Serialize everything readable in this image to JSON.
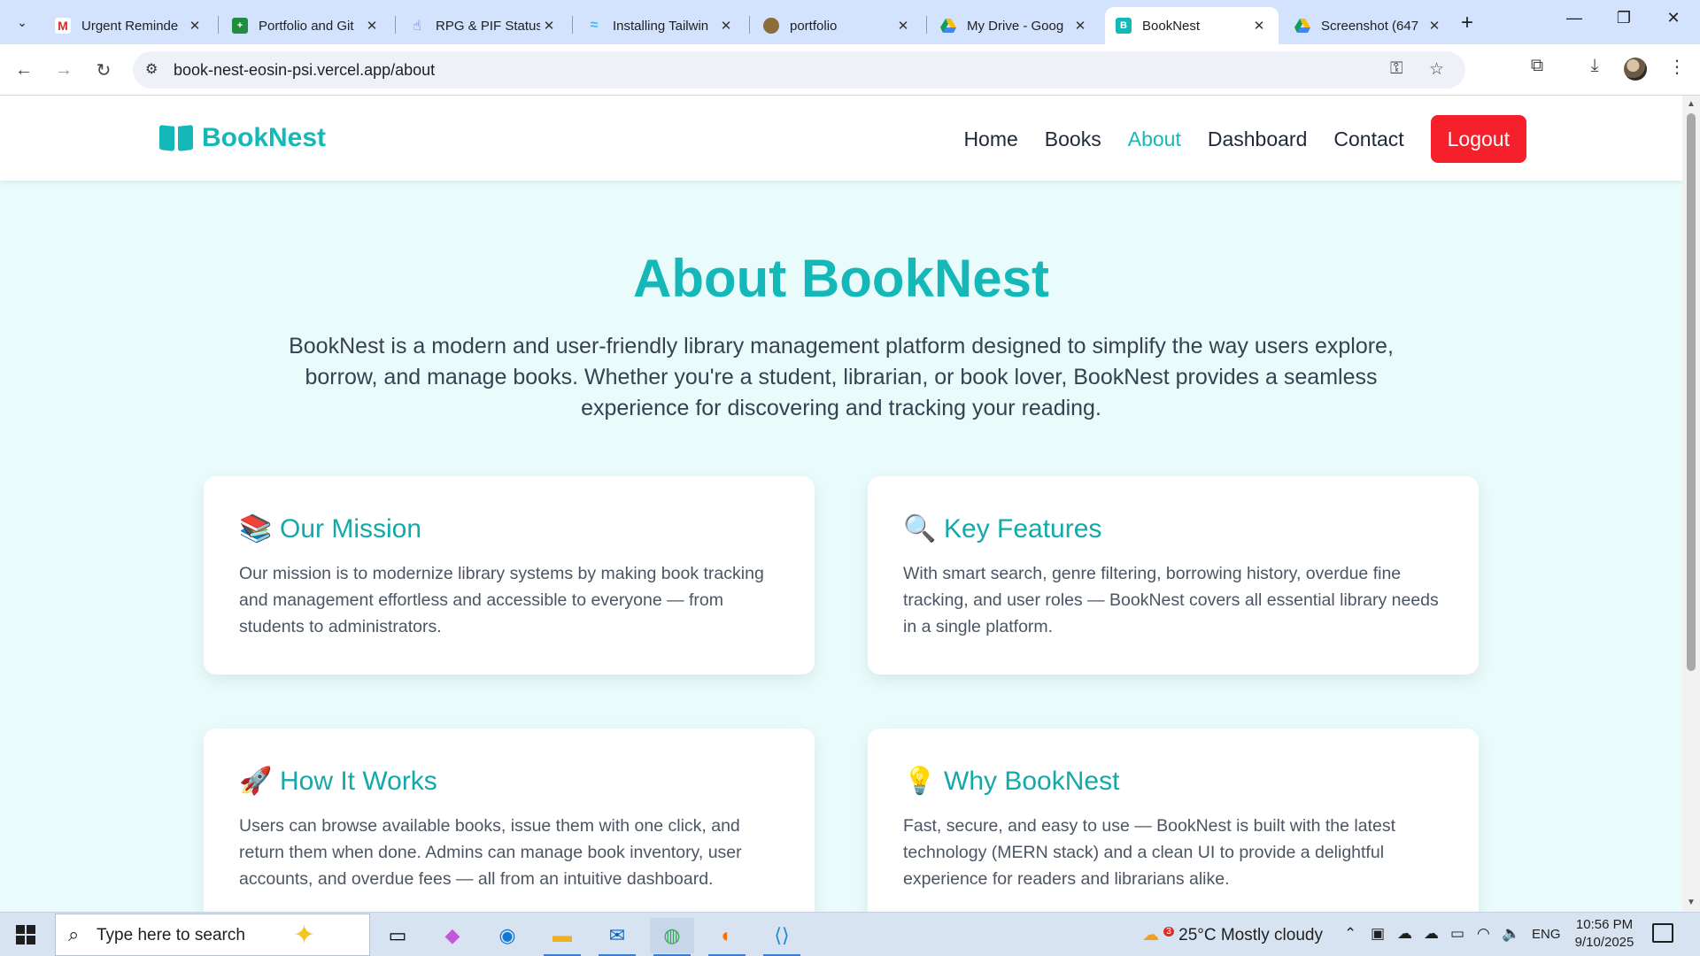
{
  "browser": {
    "tabs": [
      {
        "title": "Urgent Reminde",
        "favicon": "gmail-icon",
        "active": false
      },
      {
        "title": "Portfolio and Git",
        "favicon": "sheets-icon",
        "active": false
      },
      {
        "title": "RPG & PIF Status",
        "favicon": "hand-icon",
        "active": false
      },
      {
        "title": "Installing Tailwin",
        "favicon": "tailwind-icon",
        "active": false
      },
      {
        "title": "portfolio",
        "favicon": "portfolio-icon",
        "active": false
      },
      {
        "title": "My Drive - Goog",
        "favicon": "drive-icon",
        "active": false
      },
      {
        "title": "BookNest",
        "favicon": "B",
        "active": true
      },
      {
        "title": "Screenshot (647",
        "favicon": "drive-icon",
        "active": false
      }
    ],
    "url": "book-nest-eosin-psi.vercel.app/about"
  },
  "site": {
    "brand": "BookNest",
    "nav": [
      {
        "label": "Home",
        "active": false
      },
      {
        "label": "Books",
        "active": false
      },
      {
        "label": "About",
        "active": true
      },
      {
        "label": "Dashboard",
        "active": false
      },
      {
        "label": "Contact",
        "active": false
      }
    ],
    "logout_label": "Logout",
    "accent_color": "#14b8b8",
    "logout_color": "#f5202c"
  },
  "about": {
    "title": "About BookNest",
    "description": "BookNest is a modern and user-friendly library management platform designed to simplify the way users explore, borrow, and manage books. Whether you're a student, librarian, or book lover, BookNest provides a seamless experience for discovering and tracking your reading.",
    "cards": [
      {
        "emoji": "📚",
        "icon": "books-icon",
        "heading": "Our Mission",
        "text": "Our mission is to modernize library systems by making book tracking and management effortless and accessible to everyone — from students to administrators."
      },
      {
        "emoji": "🔍",
        "icon": "magnifier-icon",
        "heading": "Key Features",
        "text": "With smart search, genre filtering, borrowing history, overdue fine tracking, and user roles — BookNest covers all essential library needs in a single platform."
      },
      {
        "emoji": "🚀",
        "icon": "rocket-icon",
        "heading": "How It Works",
        "text": "Users can browse available books, issue them with one click, and return them when done. Admins can manage book inventory, user accounts, and overdue fees — all from an intuitive dashboard."
      },
      {
        "emoji": "💡",
        "icon": "lightbulb-icon",
        "heading": "Why BookNest",
        "text": "Fast, secure, and easy to use — BookNest is built with the latest technology (MERN stack) and a clean UI to provide a delightful experience for readers and librarians alike."
      }
    ]
  },
  "taskbar": {
    "search_placeholder": "Type here to search",
    "weather": "25°C  Mostly cloudy",
    "weather_badge": "3",
    "language": "ENG",
    "time": "10:56 PM",
    "date": "9/10/2025"
  }
}
